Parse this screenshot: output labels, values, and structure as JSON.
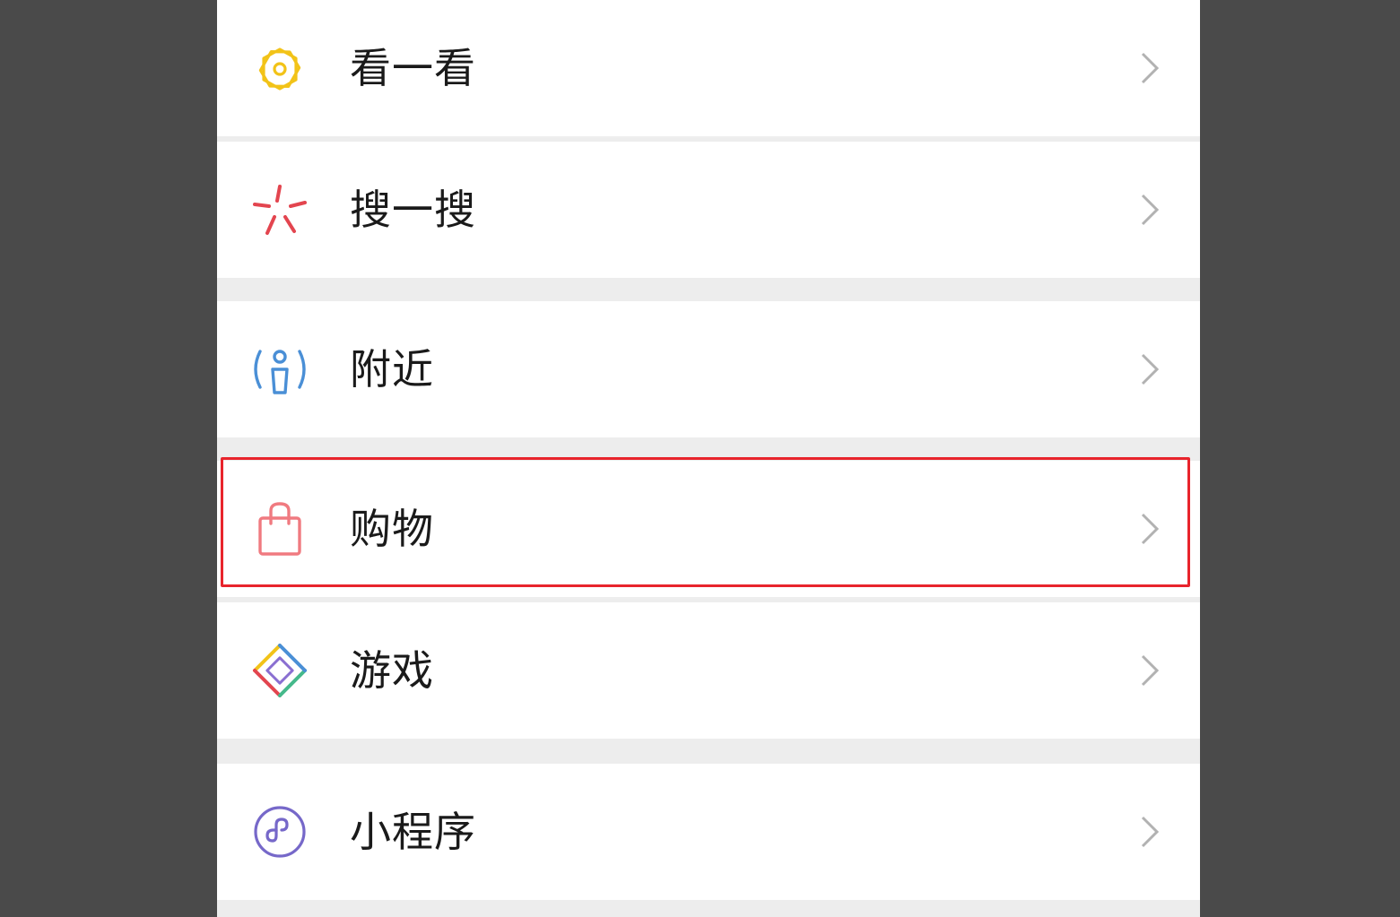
{
  "menu": {
    "items": [
      {
        "label": "看一看",
        "icon": "top-stories-icon",
        "icon_color": "#f2c318"
      },
      {
        "label": "搜一搜",
        "icon": "search-burst-icon",
        "icon_color": "#e3454f"
      },
      {
        "label": "附近",
        "icon": "nearby-person-icon",
        "icon_color": "#4a8fd6"
      },
      {
        "label": "购物",
        "icon": "shopping-bag-icon",
        "icon_color": "#f07a80"
      },
      {
        "label": "游戏",
        "icon": "game-diamond-icon",
        "icon_color": "multicolor"
      },
      {
        "label": "小程序",
        "icon": "mini-program-icon",
        "icon_color": "#7668c9"
      }
    ],
    "highlighted_item": "购物",
    "highlight_color": "#e8242c",
    "chevron_icon": "chevron-right-icon",
    "chevron_color": "#b2b2b2"
  },
  "colors": {
    "backdrop": "#4a4a4a",
    "page_background": "#ededed",
    "row_background": "#ffffff"
  }
}
